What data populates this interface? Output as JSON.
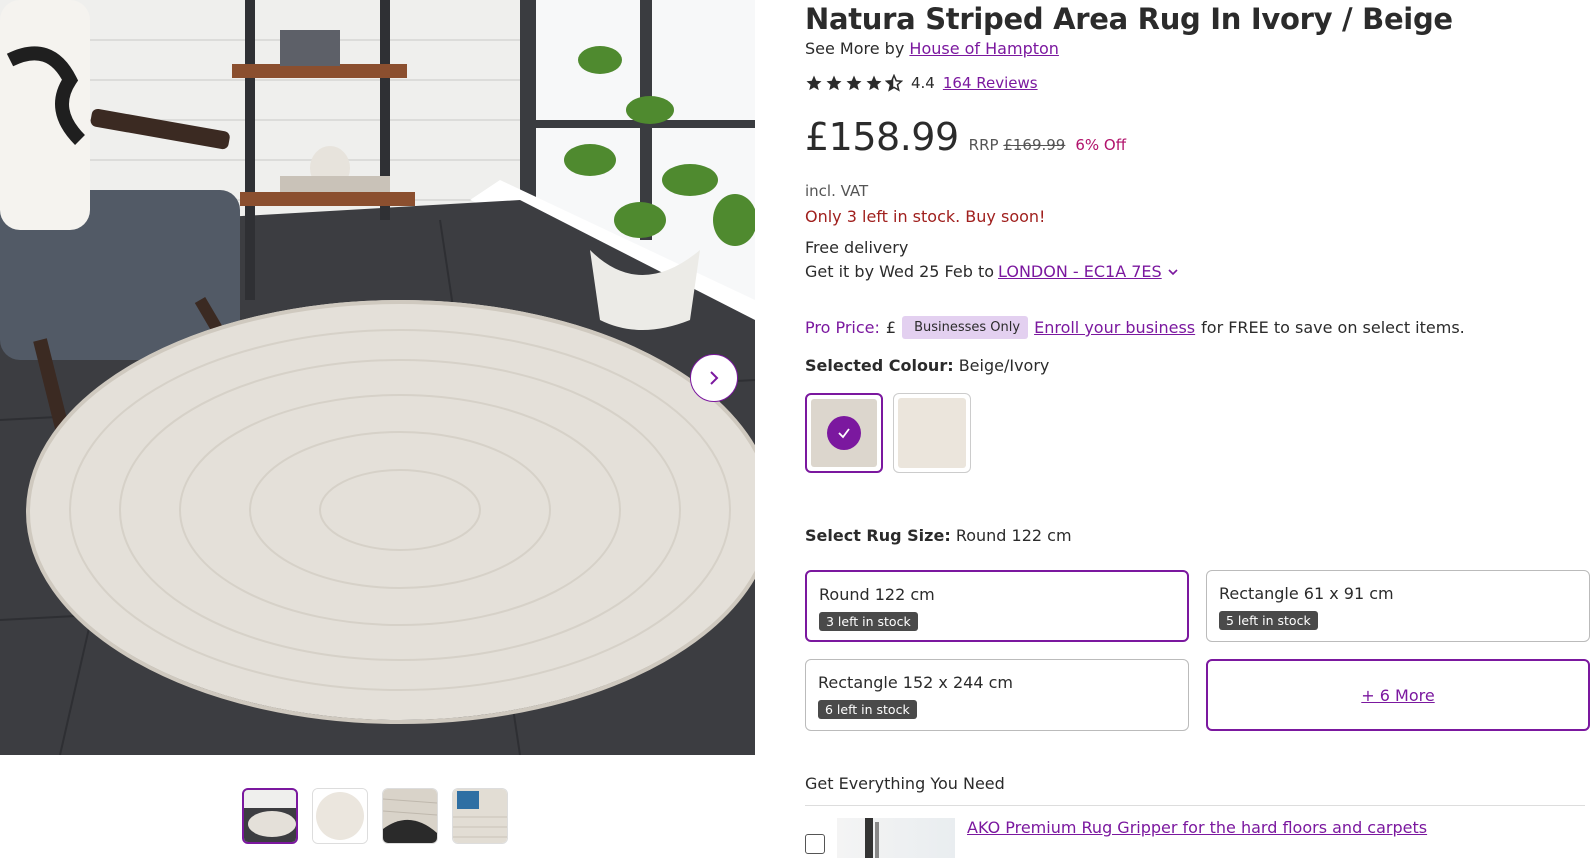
{
  "product": {
    "title": "Natura Striped Area Rug In Ivory / Beige",
    "see_more_prefix": "See More by",
    "brand": "House of Hampton",
    "rating_value": "4.4",
    "stars_out_of_5": 4.4,
    "reviews_label": "164 Reviews"
  },
  "pricing": {
    "price": "£158.99",
    "rrp_label": "RRP",
    "rrp_value": "£169.99",
    "discount": "6% Off",
    "vat": "incl. VAT",
    "stock_warning": "Only 3 left in stock. Buy soon!"
  },
  "delivery": {
    "free": "Free delivery",
    "date_prefix": "Get it by Wed 25 Feb to",
    "location": "LONDON - EC1A 7ES"
  },
  "pro": {
    "label": "Pro Price:",
    "currency": "£",
    "badge": "Businesses Only",
    "enroll_link": "Enroll your business",
    "suffix": "for FREE to save on select items."
  },
  "colour": {
    "label": "Selected Colour:",
    "value": "Beige/Ivory",
    "swatches": [
      {
        "color": "#dcd6cd",
        "selected": true
      },
      {
        "color": "#ebe5dc",
        "selected": false
      }
    ]
  },
  "size": {
    "label": "Select Rug Size:",
    "value": "Round 122 cm",
    "options": [
      {
        "name": "Round 122 cm",
        "stock": "3 left in stock"
      },
      {
        "name": "Rectangle 61 x 91 cm",
        "stock": "5 left in stock"
      },
      {
        "name": "Rectangle 152 x 244 cm",
        "stock": "6 left in stock"
      }
    ],
    "more": "+ 6 More"
  },
  "addons": {
    "heading": "Get Everything You Need",
    "items": [
      {
        "label": "AKO Premium Rug Gripper for the hard floors and carpets"
      }
    ]
  },
  "icons": {
    "next": "chevron-right-icon",
    "check": "check-icon",
    "chevron_down": "chevron-down-icon",
    "star": "star-icon"
  },
  "colors": {
    "accent": "#7b189f",
    "warning": "#a0201e",
    "discount": "#b1126b"
  }
}
